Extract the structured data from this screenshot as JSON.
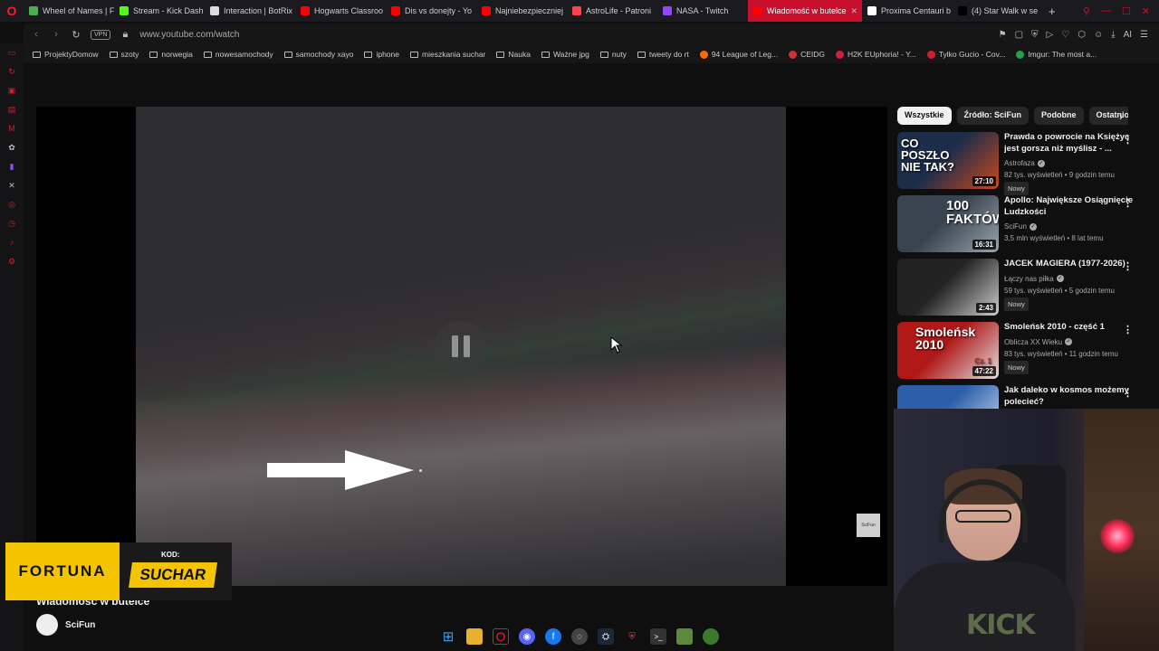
{
  "tabs": [
    {
      "label": "Wheel of Names | F",
      "color": "#4caf50"
    },
    {
      "label": "Stream - Kick Dash",
      "color": "#53fc18"
    },
    {
      "label": "Interaction | BotRix",
      "color": "#dddddd"
    },
    {
      "label": "Hogwarts Classroo",
      "color": "#ff0000"
    },
    {
      "label": "Dis vs donejty - Yo",
      "color": "#ff0000"
    },
    {
      "label": "Najniebezpieczniej",
      "color": "#ff0000"
    },
    {
      "label": "AstroLife - Patroni",
      "color": "#ff424d"
    },
    {
      "label": "NASA - Twitch",
      "color": "#9146ff"
    },
    {
      "label": "Wiadomość w butelce",
      "color": "#ff0000",
      "active": true
    },
    {
      "label": "Proxima Centauri b",
      "color": "#ffffff"
    },
    {
      "label": "(4) Star Walk w se",
      "color": "#000000"
    }
  ],
  "address": {
    "vpn_label": "VPN",
    "url": "www.youtube.com/watch"
  },
  "bookmarks": [
    {
      "label": "ProjektyDomow"
    },
    {
      "label": "szoty"
    },
    {
      "label": "norwegia"
    },
    {
      "label": "nowesamochody"
    },
    {
      "label": "samochody xayo"
    },
    {
      "label": "iphone"
    },
    {
      "label": "mieszkania suchar"
    },
    {
      "label": "Nauka"
    },
    {
      "label": "Ważne jpg"
    },
    {
      "label": "nuty"
    },
    {
      "label": "tweety do rt"
    },
    {
      "label": "94 League of Leg..."
    },
    {
      "label": "CEIDG"
    },
    {
      "label": "H2K EUphoria! - Y..."
    },
    {
      "label": "Tylko Gucio - Cov..."
    },
    {
      "label": "Imgur: The most a..."
    }
  ],
  "player": {
    "state": "paused-overlay",
    "watermark": "SciFun"
  },
  "video": {
    "title": "Wiadomość w butelce",
    "channel": "SciFun"
  },
  "chips": [
    "Wszystkie",
    "Źródło: SciFun",
    "Podobne",
    "Ostatnio"
  ],
  "recommendations": [
    {
      "thumb_text": "CO POSZŁO NIE TAK?",
      "title": "Prawda o powrocie na Księżyc jest gorsza niż myślisz - ...",
      "channel": "Astrofaza",
      "meta": "82 tys. wyświetleń • 9 godzin temu",
      "duration": "27:10",
      "new": "Nowy",
      "colors": [
        "#1c2d4a",
        "#c84a1e"
      ]
    },
    {
      "thumb_text": "100 FAKTÓW",
      "title": "Apollo: Największe Osiągnięcie Ludzkości",
      "channel": "SciFun",
      "meta": "3,5 mln wyświetleń • 8 lat temu",
      "duration": "16:31",
      "new": "",
      "colors": [
        "#3a4450",
        "#9aa4ad"
      ]
    },
    {
      "thumb_text": "",
      "title": "JACEK MAGIERA (1977-2026)",
      "channel": "Łączy nas piłka",
      "meta": "59 tys. wyświetleń • 5 godzin temu",
      "duration": "2:43",
      "new": "Nowy",
      "colors": [
        "#222222",
        "#cccccc"
      ]
    },
    {
      "thumb_text": "Smoleńsk 2010",
      "thumb_sub": "Cz. 1",
      "title": "Smoleńsk 2010 - część 1",
      "channel": "Oblicza XX Wieku",
      "meta": "83 tys. wyświetleń • 11 godzin temu",
      "duration": "47:22",
      "new": "Nowy",
      "colors": [
        "#b01818",
        "#e0e0e0"
      ]
    },
    {
      "thumb_text": "",
      "title": "Jak daleko w kosmos możemy polecieć?",
      "channel": "",
      "meta": "",
      "duration": "",
      "new": "",
      "colors": [
        "#2d5fa8",
        "#cfe0f5"
      ]
    }
  ],
  "fortuna": {
    "brand": "FORTUNA",
    "code_label": "KOD:",
    "code": "SUCHAR"
  },
  "webcam": {
    "shirt_text": "KICK"
  }
}
